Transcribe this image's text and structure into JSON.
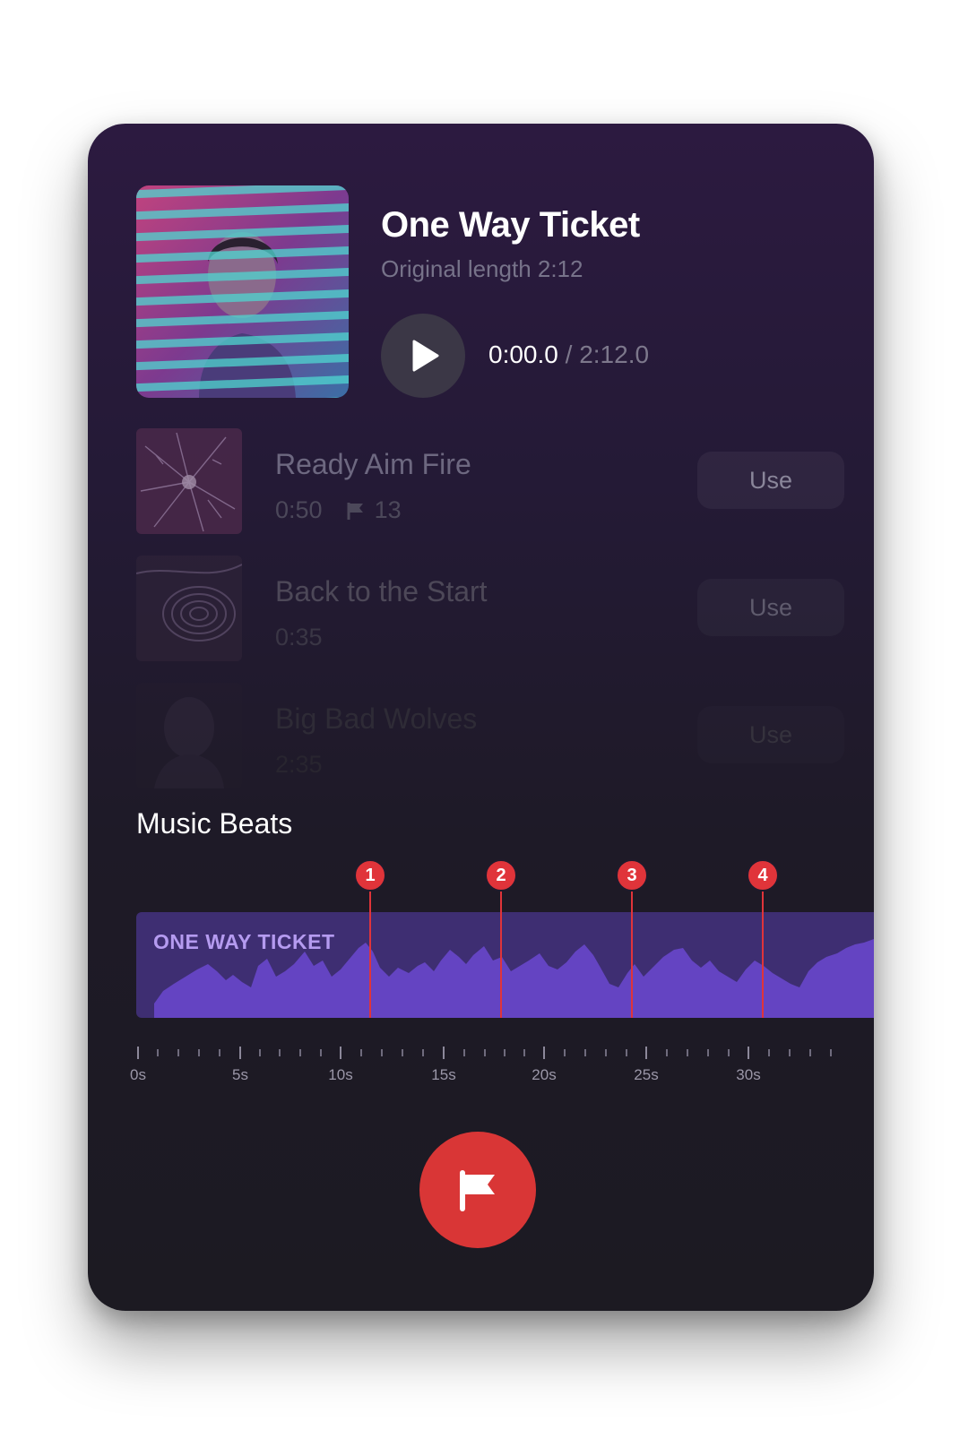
{
  "now_playing": {
    "title": "One Way Ticket",
    "subtitle": "Original length 2:12",
    "current_time": "0:00.0",
    "separator": "/",
    "total_time": "2:12.0",
    "play_icon": "play-icon"
  },
  "tracks": [
    {
      "name": "Ready Aim Fire",
      "duration": "0:50",
      "beats": "13",
      "use_label": "Use"
    },
    {
      "name": "Back to the Start",
      "duration": "0:35",
      "use_label": "Use"
    },
    {
      "name": "Big Bad Wolves",
      "duration": "2:35",
      "use_label": "Use"
    }
  ],
  "beats": {
    "heading": "Music Beats",
    "waveform_label": "ONE WAY TICKET",
    "markers": [
      "1",
      "2",
      "3",
      "4"
    ],
    "ruler_labels": [
      "0s",
      "5s",
      "10s",
      "15s",
      "20s",
      "25s",
      "30s"
    ]
  },
  "colors": {
    "accent_red": "#e0343a",
    "waveform_bg": "#3e2e72",
    "waveform_fill": "#6444c2",
    "waveform_label": "#b59bf0"
  },
  "icons": {
    "flag_button": "flag-icon"
  }
}
